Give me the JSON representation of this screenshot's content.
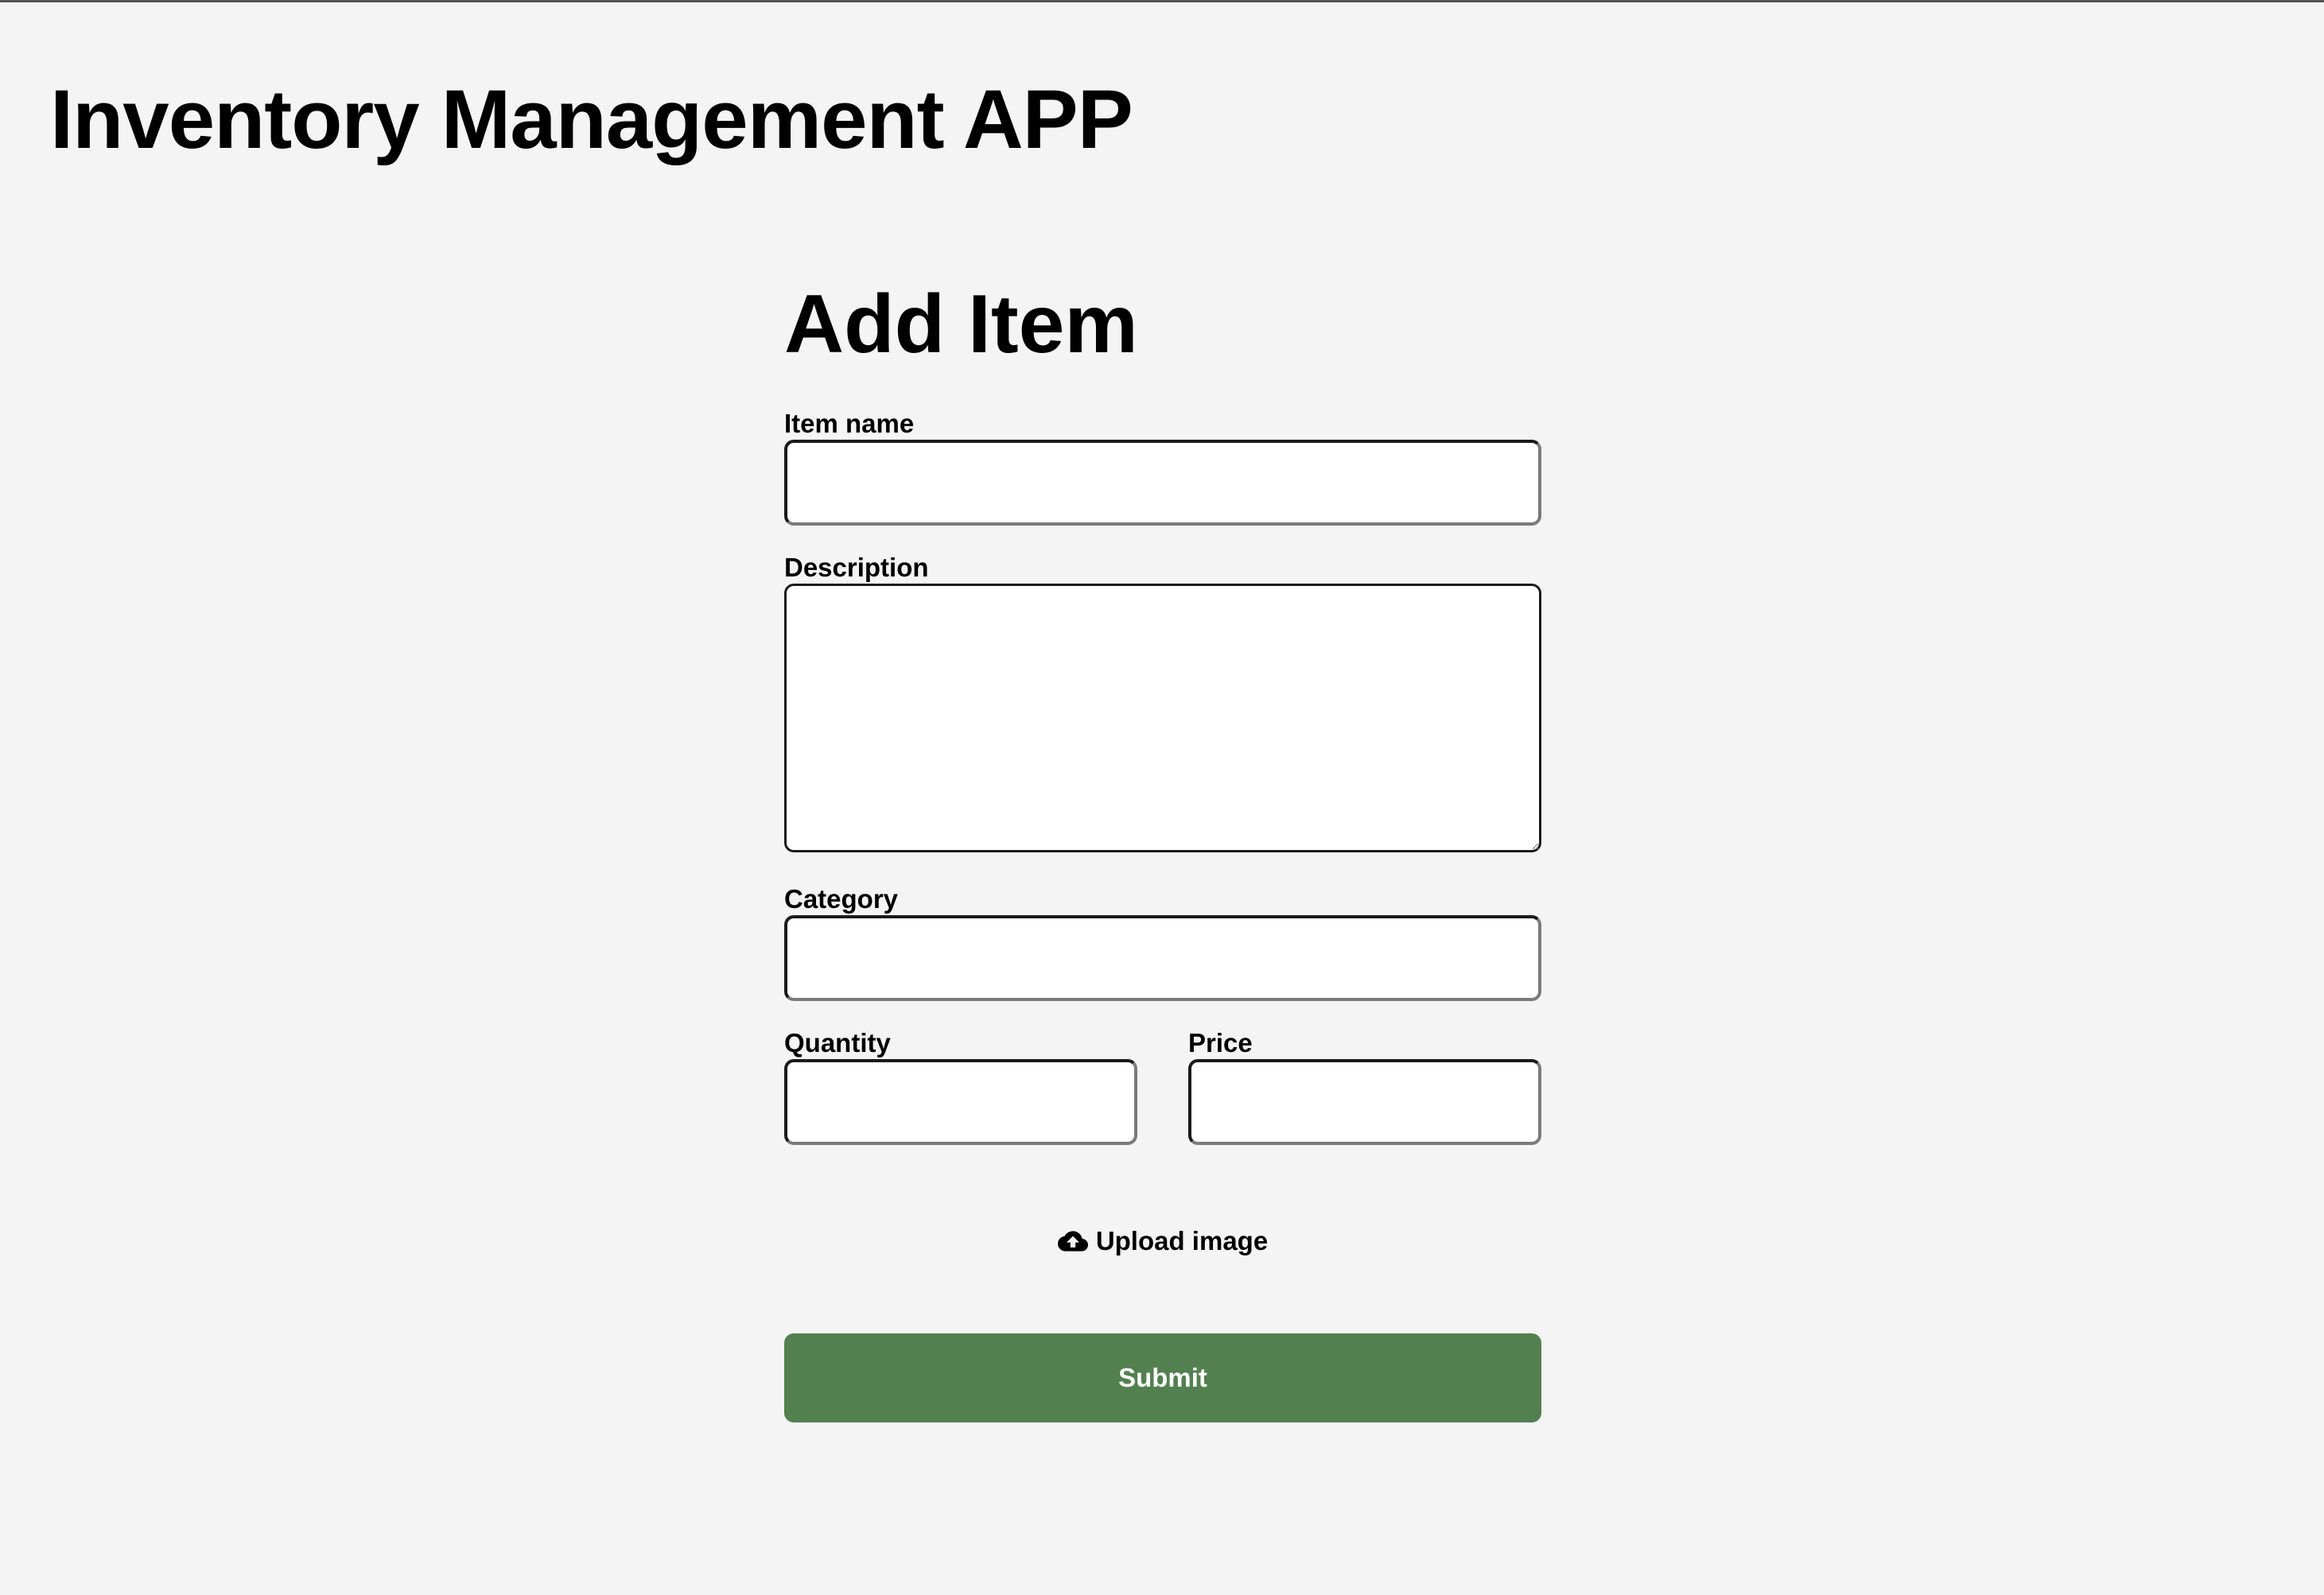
{
  "header": {
    "title": "Inventory Management APP"
  },
  "form": {
    "title": "Add Item",
    "fields": {
      "item_name": {
        "label": "Item name",
        "value": ""
      },
      "description": {
        "label": "Description",
        "value": ""
      },
      "category": {
        "label": "Category",
        "value": ""
      },
      "quantity": {
        "label": "Quantity",
        "value": ""
      },
      "price": {
        "label": "Price",
        "value": ""
      }
    },
    "upload": {
      "label": "Upload image",
      "icon": "cloud-upload-icon"
    },
    "submit_label": "Submit"
  },
  "colors": {
    "background": "#f4f4f4",
    "submit_button": "#52804e",
    "submit_text": "#ffffff"
  }
}
